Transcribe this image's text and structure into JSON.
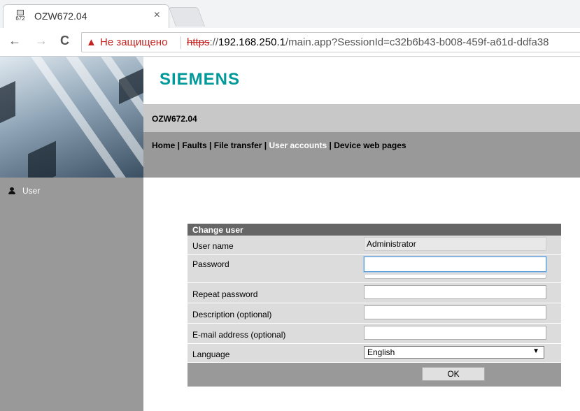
{
  "browser": {
    "tab_title": "OZW672.04",
    "favicon_text": "672",
    "close_glyph": "×",
    "security_warning": "Не защищено",
    "url_scheme": "https",
    "url_sep": "://",
    "url_host": "192.168.250.1",
    "url_rest": "/main.app?SessionId=c32b6b43-b008-459f-a61d-ddfa38",
    "back_glyph": "←",
    "forward_glyph": "→",
    "reload_glyph": "C"
  },
  "header": {
    "logo": "SIEMENS",
    "logo_color": "#009999",
    "device_name": "OZW672.04"
  },
  "menu": {
    "home": "Home",
    "faults": "Faults",
    "file_transfer": "File transfer",
    "user_accounts": "User accounts",
    "device_web_pages": "Device web pages",
    "separator": " | "
  },
  "sidebar": {
    "items": [
      {
        "label": "User",
        "icon": "user-icon"
      }
    ]
  },
  "form": {
    "title": "Change user",
    "fields": {
      "user_name": {
        "label": "User name",
        "value": "Administrator"
      },
      "password": {
        "label": "Password",
        "value": ""
      },
      "repeat_password": {
        "label": "Repeat password",
        "value": ""
      },
      "description": {
        "label": "Description (optional)",
        "value": ""
      },
      "email": {
        "label": "E-mail address (optional)",
        "value": ""
      },
      "language": {
        "label": "Language",
        "value": "English"
      }
    },
    "ok_label": "OK"
  }
}
